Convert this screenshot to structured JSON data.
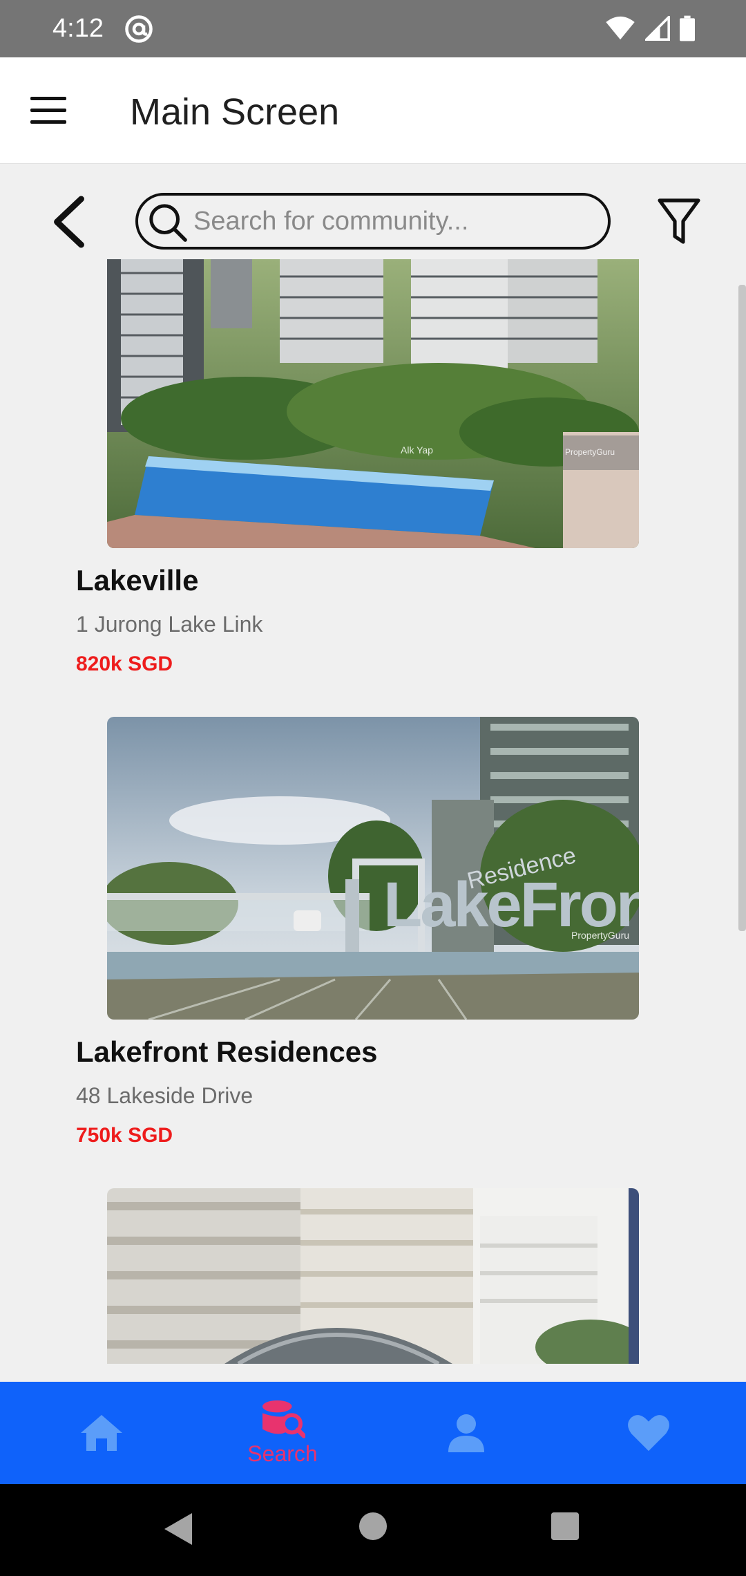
{
  "status_bar": {
    "time": "4:12",
    "icons": [
      "at-sign-icon",
      "wifi-icon",
      "cellular-signal-icon",
      "battery-icon"
    ]
  },
  "app_bar": {
    "title": "Main Screen",
    "menu_icon": "hamburger-menu-icon"
  },
  "search": {
    "placeholder": "Search for community...",
    "value": "",
    "back_icon": "chevron-left-icon",
    "filter_icon": "filter-funnel-icon"
  },
  "listings": [
    {
      "name": "Lakeville",
      "address": "1 Jurong Lake Link",
      "price": "820k SGD",
      "image": "condo towers with pool photo",
      "image_text": [
        "Alk Yap",
        "PropertyGuru"
      ]
    },
    {
      "name": "Lakefront Residences",
      "address": "48 Lakeside Drive",
      "price": "750k SGD",
      "image": "Lakefront Residences entrance sign photo",
      "image_text": [
        "LakeFront",
        "Residence",
        "PropertyGuru"
      ]
    },
    {
      "name": "",
      "address": "",
      "price": "",
      "image": "white condo building with arched canopy photo"
    }
  ],
  "bottom_nav": {
    "items": [
      {
        "icon": "home-icon",
        "label": "",
        "active": false
      },
      {
        "icon": "search-database-icon",
        "label": "Search",
        "active": true
      },
      {
        "icon": "person-icon",
        "label": "",
        "active": false
      },
      {
        "icon": "heart-icon",
        "label": "",
        "active": false
      }
    ]
  },
  "colors": {
    "status_bar": "#757575",
    "nav_background": "#0f62fa",
    "nav_inactive": "#5b9df9",
    "nav_active": "#e8336e",
    "price": "#ee1c1c",
    "page_background": "#f0f0f0"
  },
  "system_nav": [
    "back-triangle-icon",
    "home-circle-icon",
    "recents-square-icon"
  ]
}
